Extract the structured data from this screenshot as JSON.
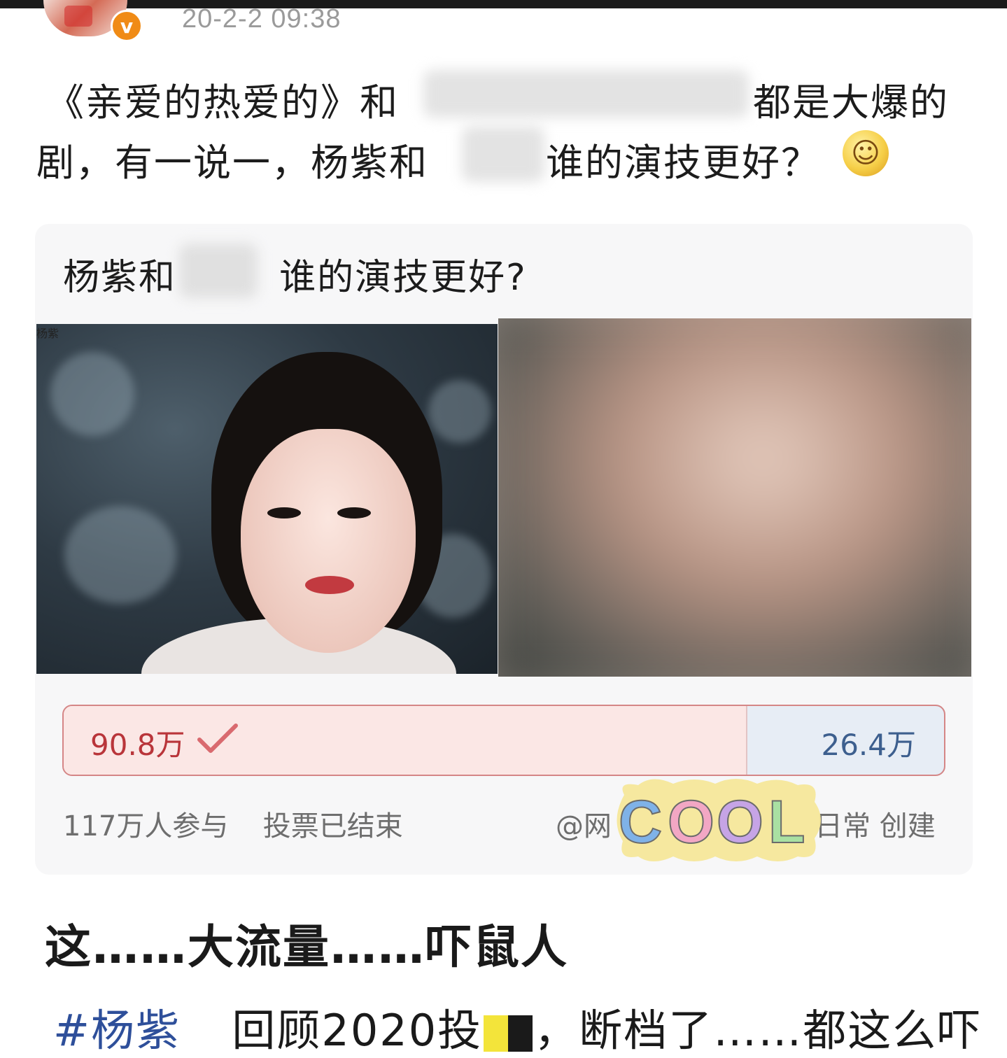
{
  "post": {
    "time": "20-2-2 09:38",
    "text_line1_start": "《亲爱的热爱的》和",
    "text_line1_end": "都是大爆的",
    "text_line2_start": "剧，有一说一，杨紫和",
    "text_line2_end": "谁的演技更好？",
    "emoji_icon": "thinking-face-icon"
  },
  "poll": {
    "question_start": "杨紫和",
    "question_end": "谁的演技更好?",
    "option_left_caption": "杨紫",
    "left_votes": "90.8万",
    "right_votes": "26.4万",
    "left_share": 0.775,
    "participants": "117万人参与",
    "status": "投票已结束",
    "creator_prefix": "@网",
    "creator_suffix": "日常 创建",
    "sticker_text": "COOL"
  },
  "comment": {
    "text": "这……大流量……吓鼠人"
  },
  "tagline": {
    "hashtag": "#杨紫",
    "text_a": "回顾2020投",
    "text_b": "，断档了……都这么吓"
  },
  "colors": {
    "left_bar": "#fbe7e5",
    "left_count": "#b9353a",
    "right_bar": "#e7edf5",
    "right_count": "#3d5f8e",
    "verified_badge": "#f08b16"
  }
}
